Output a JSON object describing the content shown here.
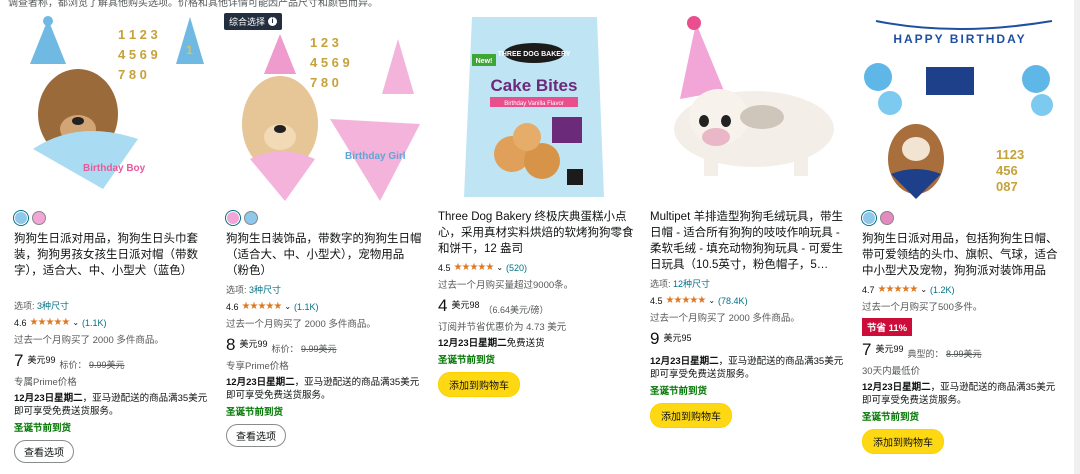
{
  "top_note": "调查者称，都浏览了解其他购买选项。价格和其他详情可能因产品尺寸和颜色而异。",
  "colors": {
    "link": "#007185",
    "star": "#de7921",
    "deal": "#cc0c39",
    "button_yellow": "#ffd814",
    "green": "#007600"
  },
  "cards": [
    {
      "image_alt": "dog-bandana-birthday-boy-blue",
      "swatches": [
        "#8fc8ea",
        "#f2a6d8"
      ],
      "title": "狗狗生日派对用品，狗狗生日头巾套装，狗狗男孩女孩生日派对帽（带数字），适合大、中、小型犬（蓝色）",
      "options_label": "选项:",
      "options_value": "3种尺寸",
      "rating": "4.6",
      "stars": "★★★★★",
      "review_count": "(1.1K)",
      "bought": "过去一个月购买了 2000 多件商品。",
      "price_whole": "7",
      "price_sup": "美元99",
      "list_label": "标价：",
      "list_value": "9.99美元",
      "prime": "专属Prime价格",
      "ship_date": "12月23日星期二",
      "ship_text": "，亚马逊配送的商品满35美元即可享受免费送货服务。",
      "xmas": "圣诞节前到货",
      "button": "查看选项"
    },
    {
      "image_alt": "dog-bandana-birthday-girl-pink",
      "badge": "综合选择",
      "swatches": [
        "#f2a6d8",
        "#8fc8ea"
      ],
      "title": "狗狗生日装饰品，带数字的狗狗生日帽（适合大、中、小型犬），宠物用品（粉色）",
      "options_label": "选项:",
      "options_value": "3种尺寸",
      "rating": "4.6",
      "stars": "★★★★★",
      "review_count": "(1.1K)",
      "bought": "过去一个月购买了 2000 多件商品。",
      "price_whole": "8",
      "price_sup": "美元99",
      "list_label": "标价：",
      "list_value": "9.99美元",
      "prime": "专享Prime价格",
      "ship_date": "12月23日星期二",
      "ship_text": "，亚马逊配送的商品满35美元即可享受免费送货服务。",
      "xmas": "圣诞节前到货",
      "button": "查看选项"
    },
    {
      "image_alt": "three-dog-bakery-cake-bites-bag",
      "title": "Three Dog Bakery 终极庆典蛋糕小点心，采用真材实料烘焙的软烤狗狗零食和饼干，12 盎司",
      "rating": "4.5",
      "stars": "★★★★★",
      "review_count": "(520)",
      "bought": "过去一个月购买量超过9000条。",
      "price_whole": "4",
      "price_sup": "美元98",
      "unit_price": "（6.64美元/磅）",
      "subscribe": "订阅并节省优惠价为 4.73 美元",
      "ship_date": "12月23日星期二",
      "ship_text": "免费送货",
      "xmas": "圣诞节前到货",
      "button": "添加到购物车"
    },
    {
      "image_alt": "multipet-lamb-chop-party-hat-plush",
      "title": "Multipet 羊排造型狗狗毛绒玩具，带生日帽 - 适合所有狗狗的吱吱作响玩具 - 柔软毛绒 - 填充动物狗狗玩具 - 可爱生日玩具（10.5英寸，粉色帽子，5…",
      "options_label": "选项:",
      "options_value": "12种尺寸",
      "rating": "4.5",
      "stars": "★★★★★",
      "review_count": "(78.4K)",
      "bought": "过去一个月购买了 2000 多件商品。",
      "price_whole": "9",
      "price_sup": "美元95",
      "ship_date": "12月23日星期二",
      "ship_text": "，亚马逊配送的商品满35美元即可享受免费送货服务。",
      "xmas": "圣诞节前到货",
      "button": "添加到购物车"
    },
    {
      "image_alt": "happy-birthday-banner-dog-set",
      "swatches": [
        "#8fc8ea",
        "#e58ac0"
      ],
      "title": "狗狗生日派对用品，包括狗狗生日帽、带可爱领结的头巾、旗帜、气球，适合中小型犬及宠物，狗狗派对装饰用品",
      "rating": "4.7",
      "stars": "★★★★★",
      "review_count": "(1.2K)",
      "bought": "过去一个月购买了500多件。",
      "deal": "节省 11%",
      "price_whole": "7",
      "price_sup": "美元99",
      "list_label": "典型的：",
      "list_value": "8.99美元",
      "low_price": "30天内最低价",
      "ship_date": "12月23日星期二",
      "ship_text": "，亚马逊配送的商品满35美元即可享受免费送货服务。",
      "xmas": "圣诞节前到货",
      "button": "添加到购物车"
    }
  ],
  "image_text": {
    "c1_numbers": [
      "1 1 2 3",
      "4 5 6 9",
      "7 8 0"
    ],
    "c1_bandana": "Birthday Boy",
    "c2_numbers": [
      "1 2 3",
      "4 5 6 9",
      "7 8 0"
    ],
    "c2_bandana": "Birthday Girl",
    "c3_brand": "THREE DOG BAKERY",
    "c3_new": "New!",
    "c3_product": "Cake Bites",
    "c3_flavor": "Birthday Vanilla Flavor",
    "c5_banner": "HAPPY BIRTHDAY",
    "c5_numbers": [
      "1123",
      "456",
      "087"
    ]
  }
}
